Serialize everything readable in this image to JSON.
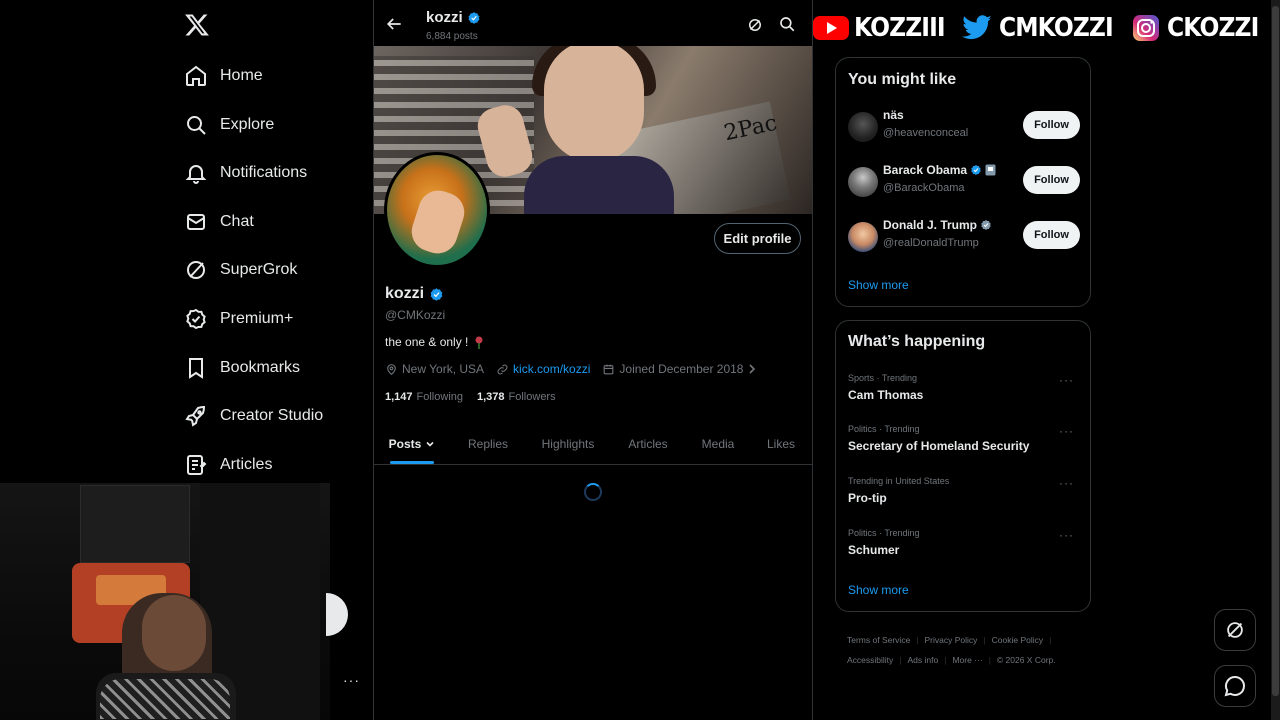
{
  "nav": {
    "logo_icon": "x-logo-icon",
    "items": [
      {
        "label": "Home",
        "icon": "home-icon"
      },
      {
        "label": "Explore",
        "icon": "search-icon"
      },
      {
        "label": "Notifications",
        "icon": "bell-icon"
      },
      {
        "label": "Chat",
        "icon": "mail-icon"
      },
      {
        "label": "SuperGrok",
        "icon": "grok-icon"
      },
      {
        "label": "Premium+",
        "icon": "verified-badge-icon"
      },
      {
        "label": "Bookmarks",
        "icon": "bookmark-icon"
      },
      {
        "label": "Creator Studio",
        "icon": "rocket-icon"
      },
      {
        "label": "Articles",
        "icon": "article-icon"
      }
    ],
    "more_label": "···"
  },
  "header": {
    "name": "kozzi",
    "posts_count": "6,884 posts"
  },
  "banner": {
    "album_text": "2Pac"
  },
  "profile": {
    "edit_label": "Edit profile",
    "name": "kozzi",
    "handle": "@CMKozzi",
    "bio": "the one & only !",
    "location": "New York, USA",
    "link": "kick.com/kozzi",
    "joined": "Joined December 2018",
    "following_count": "1,147",
    "following_label": "Following",
    "followers_count": "1,378",
    "followers_label": "Followers"
  },
  "tabs": [
    "Posts",
    "Replies",
    "Highlights",
    "Articles",
    "Media",
    "Likes"
  ],
  "social_overlay": {
    "youtube": "KOZZIII",
    "twitter": "CMKOZZI",
    "instagram": "CKOZZI"
  },
  "who_to_follow": {
    "title": "You might like",
    "users": [
      {
        "name": "näs",
        "handle": "@heavenconceal",
        "follow": "Follow"
      },
      {
        "name": "Barack Obama",
        "handle": "@BarackObama",
        "follow": "Follow"
      },
      {
        "name": "Donald J. Trump",
        "handle": "@realDonaldTrump",
        "follow": "Follow"
      }
    ],
    "show_more": "Show more"
  },
  "trends": {
    "title": "What’s happening",
    "items": [
      {
        "meta": "Sports · Trending",
        "name": "Cam Thomas"
      },
      {
        "meta": "Politics · Trending",
        "name": "Secretary of Homeland Security"
      },
      {
        "meta": "Trending in United States",
        "name": "Pro-tip"
      },
      {
        "meta": "Politics · Trending",
        "name": "Schumer"
      }
    ],
    "show_more": "Show more"
  },
  "footer": {
    "terms": "Terms of Service",
    "privacy": "Privacy Policy",
    "cookie": "Cookie Policy",
    "accessibility": "Accessibility",
    "ads": "Ads info",
    "more": "More ···",
    "copyright": "© 2026 X Corp."
  },
  "colors": {
    "accent": "#1d9bf0",
    "background": "#000000",
    "muted_text": "#71767b",
    "border": "#2f3336"
  }
}
